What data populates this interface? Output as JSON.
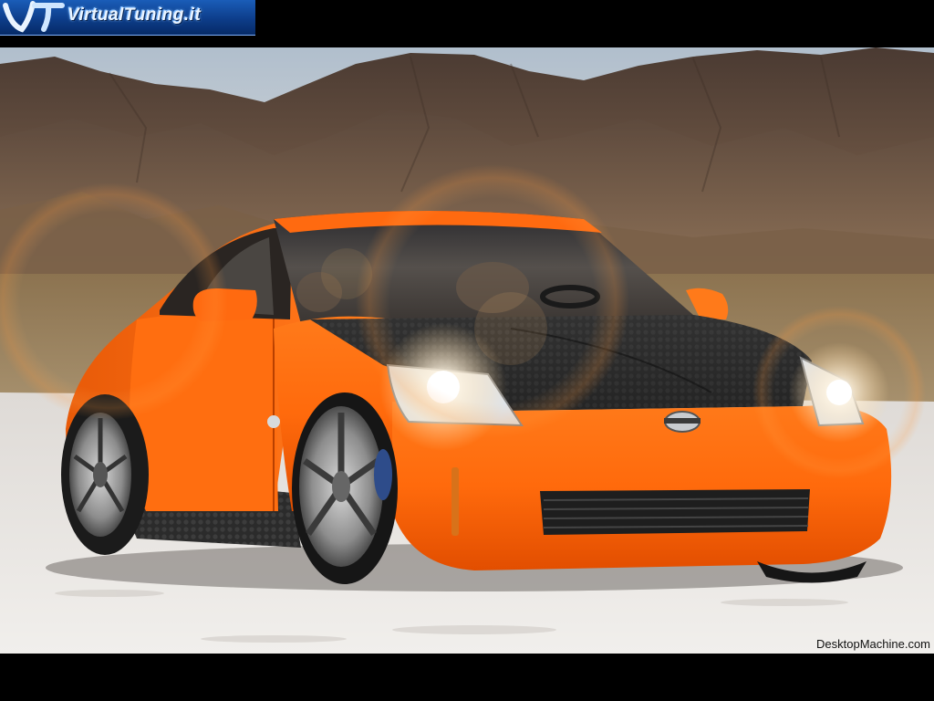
{
  "logo": {
    "text": "VirtualTuning.it",
    "mark": "VT"
  },
  "credit": {
    "text": "DesktopMachine.com"
  },
  "scene": {
    "subject": "orange-sports-coupe",
    "background": "desert-mountains",
    "ground": "salt-flat",
    "colors": {
      "car_body": "#ff6a10",
      "carbon_hood": "#2a2a2a",
      "sky": "#b9c6d3",
      "mountains": "#5a4638",
      "ground": "#e9e6e3"
    }
  }
}
